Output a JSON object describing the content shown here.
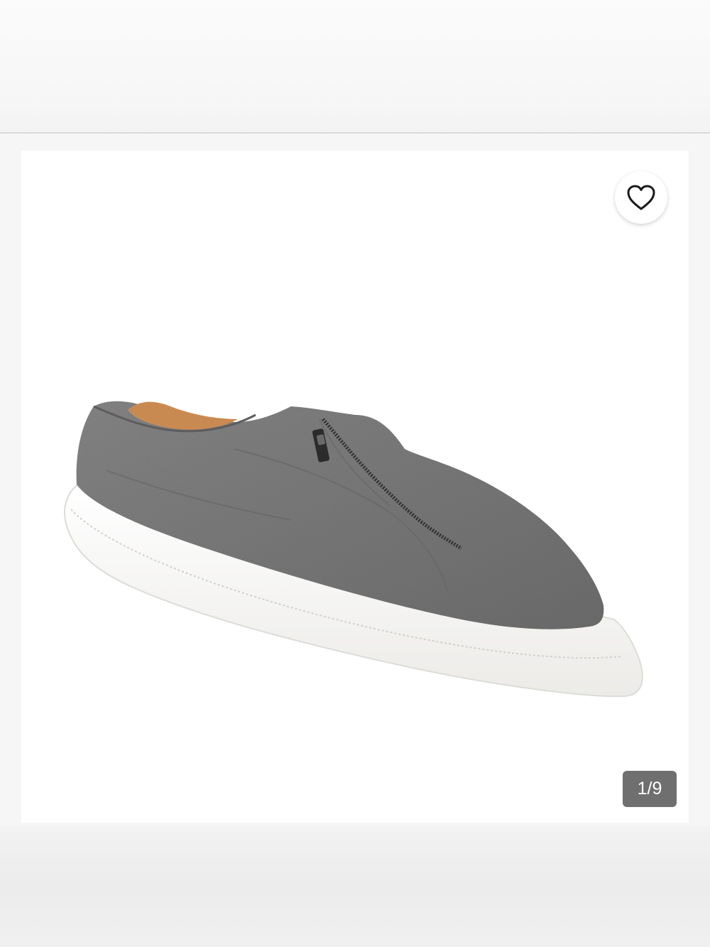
{
  "gallery": {
    "counter_text": "1/9",
    "current_index": 1,
    "total_images": 9,
    "product_image": "gray-wool-zip-front-slip-on-sneaker"
  },
  "actions": {
    "favorite_icon": "heart-outline-icon"
  },
  "colors": {
    "counter_bg": "#6f6f6f",
    "shoe_upper": "#7b7b7b",
    "sole": "#f4f4f2",
    "lining": "#c98a52"
  }
}
